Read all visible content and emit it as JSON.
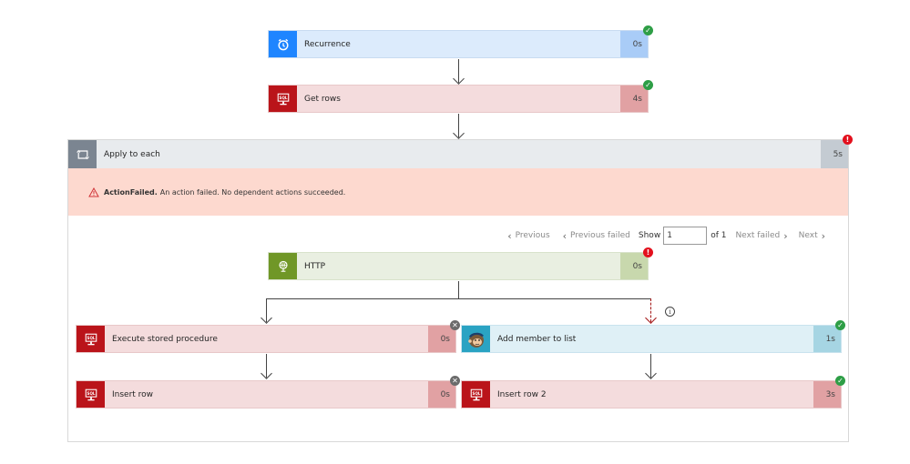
{
  "flow": {
    "recurrence": {
      "title": "Recurrence",
      "duration": "0s",
      "status": "succeeded",
      "icon": "alarm-clock-icon"
    },
    "get_rows": {
      "title": "Get rows",
      "duration": "4s",
      "status": "succeeded",
      "icon": "sql-icon"
    },
    "apply_to_each": {
      "title": "Apply to each",
      "duration": "5s",
      "status": "failed",
      "icon": "loop-icon",
      "error": {
        "code": "ActionFailed.",
        "message": "An action failed. No dependent actions succeeded."
      },
      "pager": {
        "previous": "Previous",
        "previous_failed": "Previous failed",
        "show_label": "Show",
        "current": "1",
        "of_label": "of 1",
        "next_failed": "Next failed",
        "next": "Next"
      }
    },
    "http": {
      "title": "HTTP",
      "duration": "0s",
      "status": "failed",
      "icon": "globe-icon"
    },
    "execute_stored_procedure": {
      "title": "Execute stored procedure",
      "duration": "0s",
      "status": "skipped",
      "icon": "sql-icon"
    },
    "insert_row": {
      "title": "Insert row",
      "duration": "0s",
      "status": "skipped",
      "icon": "sql-icon"
    },
    "add_member": {
      "title": "Add member to list",
      "duration": "1s",
      "status": "succeeded",
      "icon": "mailchimp-icon"
    },
    "insert_row_2": {
      "title": "Insert row 2",
      "duration": "3s",
      "status": "succeeded",
      "icon": "sql-icon"
    }
  },
  "badges": {
    "ok": "✓",
    "err": "!",
    "skip": "✕"
  },
  "info": "i",
  "colors": {
    "success": "#2e9e46",
    "failure": "#e3101d",
    "skipped": "#6b6b6b",
    "sql": "#ba141a",
    "schedule": "#1f85ff",
    "http": "#709727",
    "mailchimp": "#2aa3c3"
  }
}
